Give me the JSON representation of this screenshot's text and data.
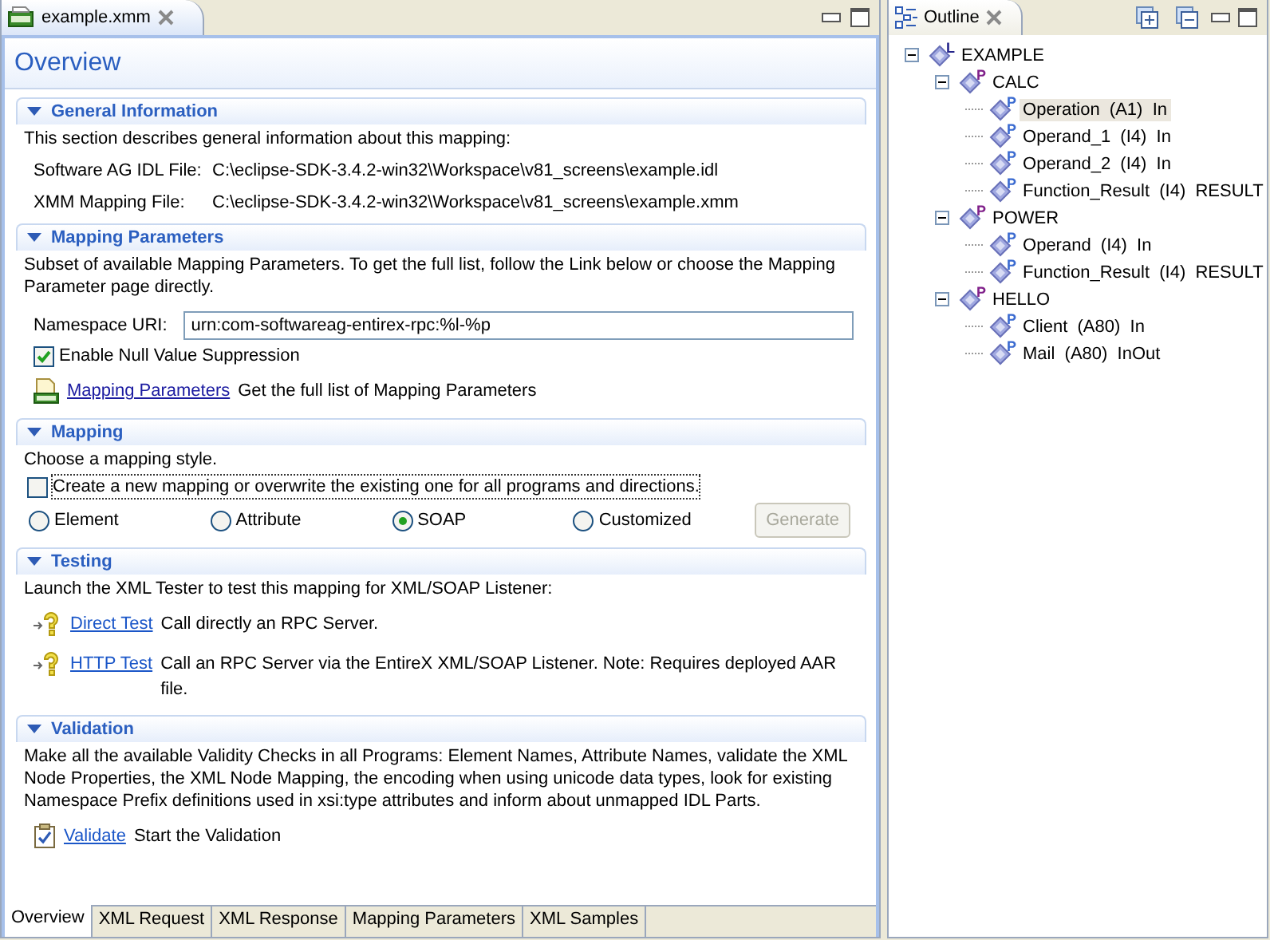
{
  "editor": {
    "tab": {
      "title": "example.xmm"
    },
    "heading": "Overview",
    "sections": [
      {
        "kind": "info",
        "expanded": true,
        "title": "General Information",
        "description": "This section describes general information about this mapping:",
        "fields": [
          {
            "label": "Software AG IDL File:",
            "value": "C:\\eclipse-SDK-3.4.2-win32\\Workspace\\v81_screens\\example.idl"
          },
          {
            "label": "XMM Mapping File:",
            "value": "C:\\eclipse-SDK-3.4.2-win32\\Workspace\\v81_screens\\example.xmm"
          }
        ]
      },
      {
        "kind": "params",
        "expanded": true,
        "title": "Mapping Parameters",
        "description": "Subset of available Mapping Parameters. To get the full list, follow the Link below or choose the Mapping Parameter page directly.",
        "namespace": {
          "label": "Namespace URI:",
          "value": "urn:com-softwareag-entirex-rpc:%l-%p"
        },
        "checkbox": {
          "label": "Enable Null Value Suppression",
          "checked": true
        },
        "link": {
          "text": "Mapping Parameters",
          "description": "Get the full list of Mapping Parameters"
        }
      },
      {
        "kind": "mapping",
        "expanded": true,
        "title": "Mapping",
        "description": "Choose a mapping style.",
        "checkbox": {
          "label": "Create a new mapping or overwrite the existing one for all programs and directions.",
          "checked": false
        },
        "options": [
          {
            "label": "Element",
            "selected": false
          },
          {
            "label": "Attribute",
            "selected": false
          },
          {
            "label": "SOAP",
            "selected": true
          },
          {
            "label": "Customized",
            "selected": false
          }
        ],
        "button": {
          "label": "Generate",
          "disabled": true
        }
      },
      {
        "kind": "testing",
        "expanded": true,
        "title": "Testing",
        "description": "Launch the XML Tester to test this mapping for XML/SOAP Listener:",
        "links": [
          {
            "text": "Direct Test",
            "description": "Call directly an RPC Server."
          },
          {
            "text": "HTTP Test",
            "description": "Call an RPC Server via the EntireX XML/SOAP Listener. Note: Requires deployed AAR file."
          }
        ]
      },
      {
        "kind": "validation",
        "expanded": true,
        "title": "Validation",
        "description": "Make all the available Validity Checks in all Programs: Element Names, Attribute Names, validate the XML Node Properties, the XML Node Mapping, the encoding when using unicode data types, look for existing Namespace Prefix definitions used in xsi:type attributes and inform about unmapped IDL Parts.",
        "links": [
          {
            "text": "Validate",
            "description": "Start the Validation"
          }
        ]
      }
    ],
    "bottom_tabs": [
      {
        "label": "Overview",
        "selected": true
      },
      {
        "label": "XML Request",
        "selected": false
      },
      {
        "label": "XML Response",
        "selected": false
      },
      {
        "label": "Mapping Parameters",
        "selected": false
      },
      {
        "label": "XML Samples",
        "selected": false
      }
    ]
  },
  "outline": {
    "title": "Outline",
    "tree": [
      {
        "label": "EXAMPLE",
        "badge": "L",
        "expanded": true,
        "selected": false,
        "children": [
          {
            "label": "CALC",
            "badge": "P",
            "expanded": true,
            "selected": false,
            "children": [
              {
                "label": "Operation  (A1)  In",
                "badge": "P",
                "selected": true
              },
              {
                "label": "Operand_1  (I4)  In",
                "badge": "P",
                "selected": false
              },
              {
                "label": "Operand_2  (I4)  In",
                "badge": "P",
                "selected": false
              },
              {
                "label": "Function_Result  (I4)  RESULT",
                "badge": "P",
                "selected": false
              }
            ]
          },
          {
            "label": "POWER",
            "badge": "P",
            "expanded": true,
            "selected": false,
            "children": [
              {
                "label": "Operand  (I4)  In",
                "badge": "P",
                "selected": false
              },
              {
                "label": "Function_Result  (I4)  RESULT",
                "badge": "P",
                "selected": false
              }
            ]
          },
          {
            "label": "HELLO",
            "badge": "P",
            "expanded": true,
            "selected": false,
            "children": [
              {
                "label": "Client  (A80)  In",
                "badge": "P",
                "selected": false
              },
              {
                "label": "Mail  (A80)  InOut",
                "badge": "P",
                "selected": false
              }
            ]
          }
        ]
      }
    ]
  }
}
